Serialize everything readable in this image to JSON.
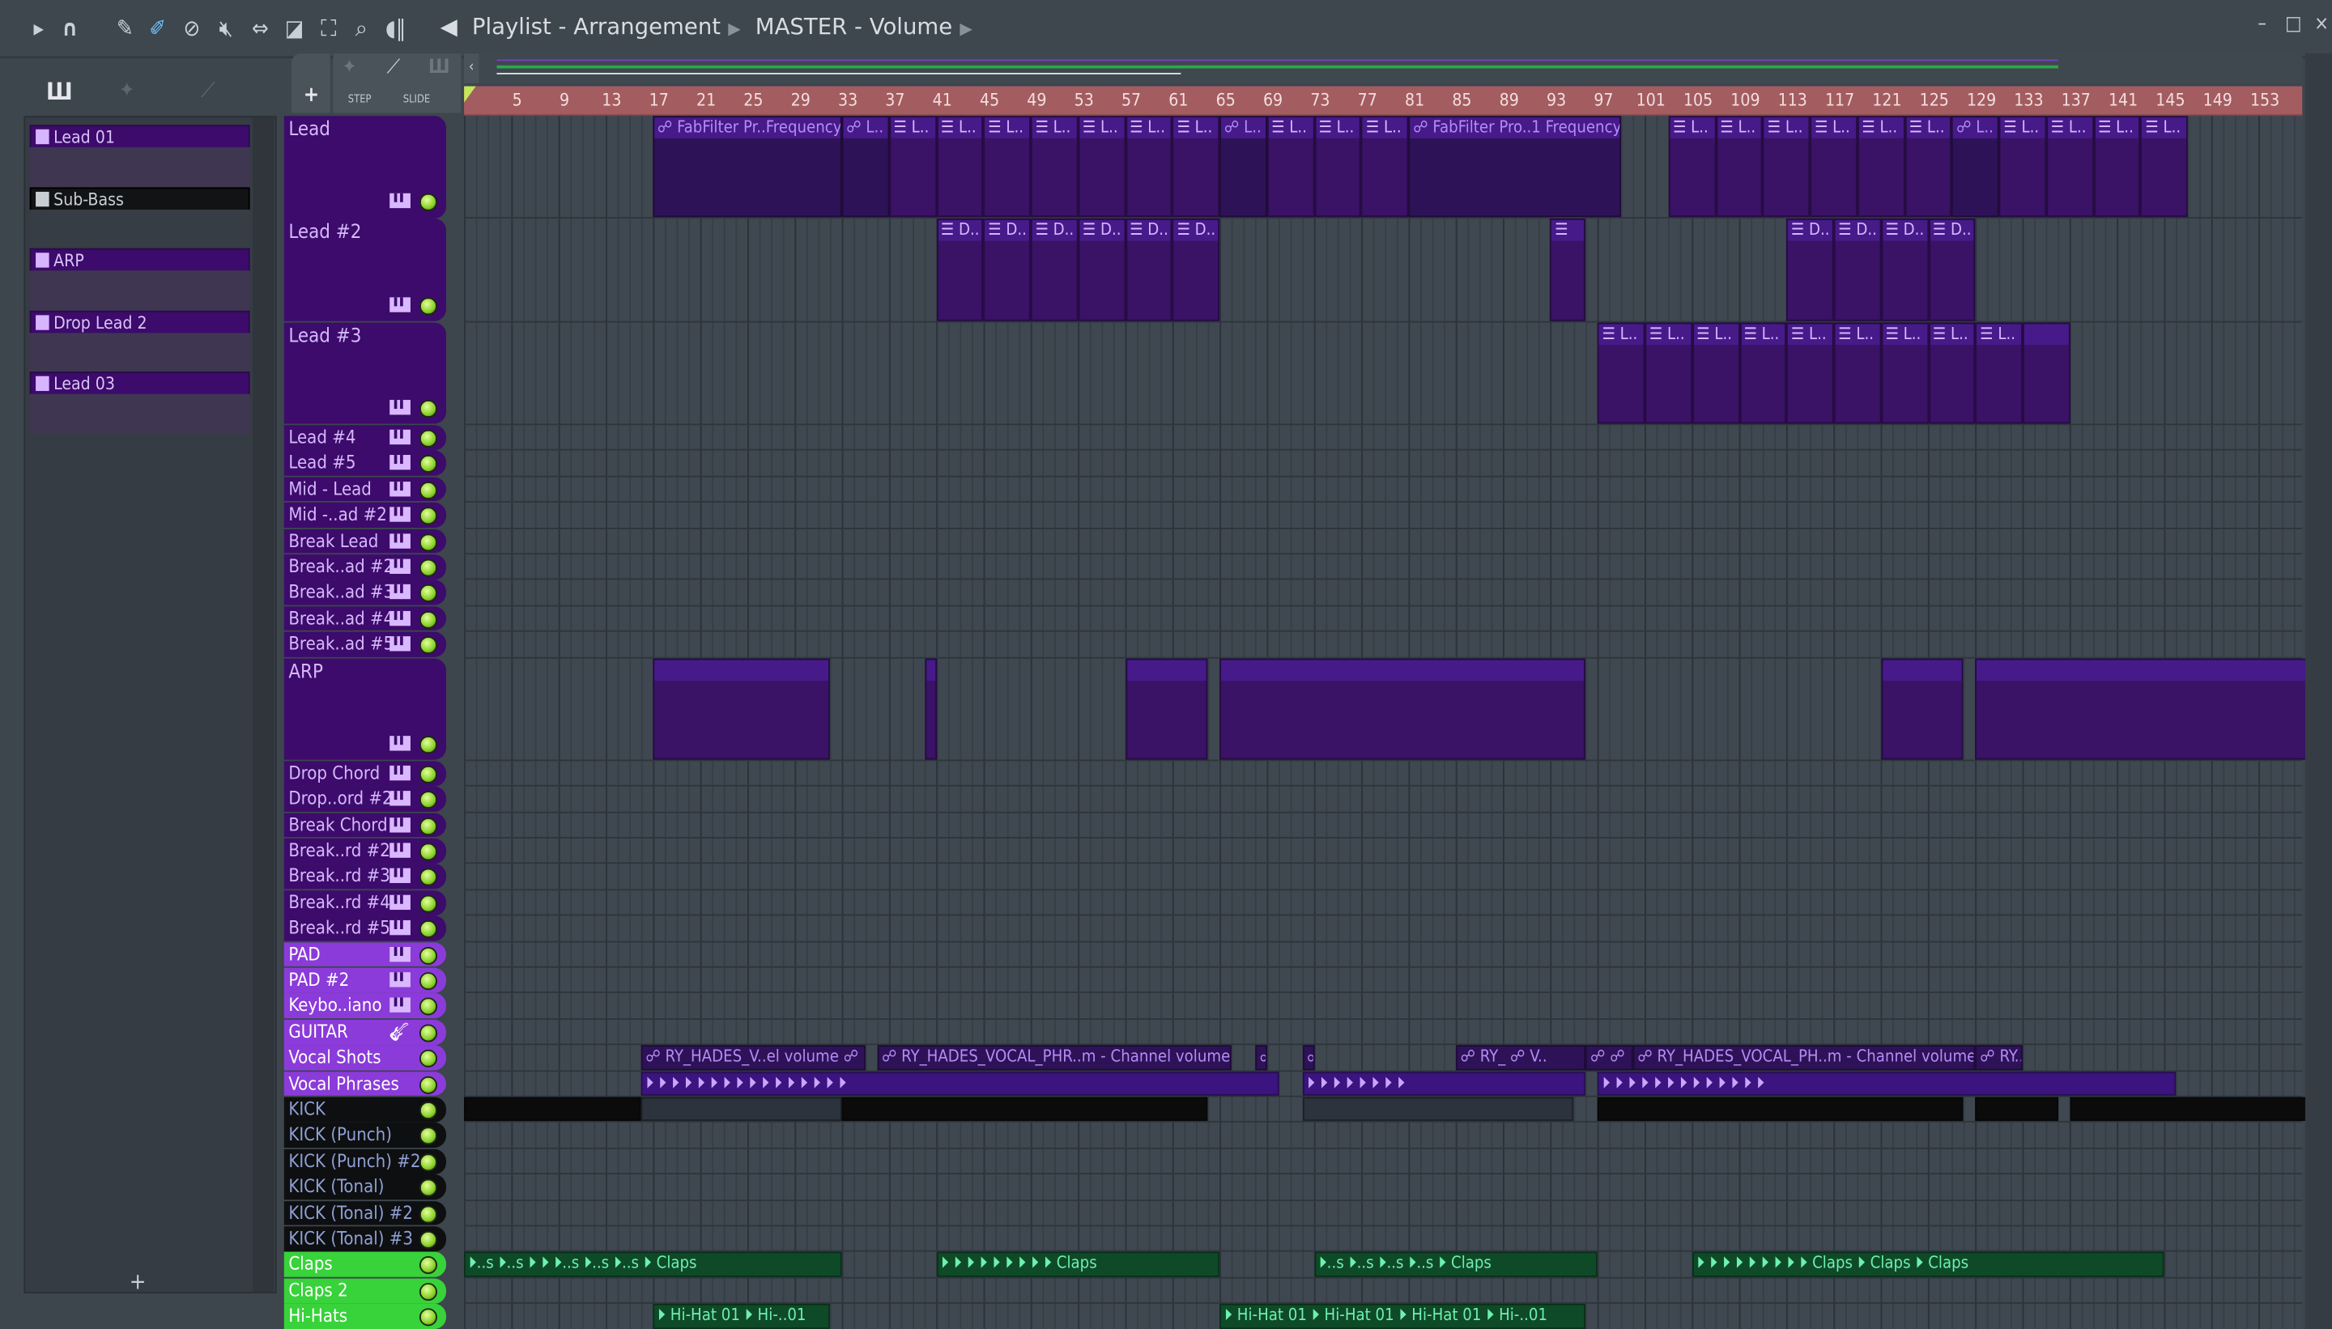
{
  "toolbar": {
    "icons": [
      "play-arrow-icon",
      "magnet-icon",
      "pencil-icon",
      "paint-brush-icon",
      "delete-icon",
      "mute-icon",
      "slip-icon",
      "slice-icon",
      "select-icon",
      "zoom-icon",
      "playback-icon"
    ],
    "breadcrumb": [
      "Playlist - Arrangement",
      "MASTER - Volume"
    ],
    "window": {
      "minimize": "–",
      "maximize": "□",
      "close": "×"
    }
  },
  "header_tools": {
    "add": "+",
    "step": "STEP",
    "slide": "SLIDE"
  },
  "picker": {
    "items": [
      {
        "label": "Lead 01",
        "selected": false
      },
      {
        "label": "Sub-Bass",
        "selected": true
      },
      {
        "label": "ARP",
        "selected": false
      },
      {
        "label": "Drop Lead 2",
        "selected": false
      },
      {
        "label": "Lead 03",
        "selected": false
      }
    ],
    "add": "+"
  },
  "ruler": {
    "bars": [
      "5",
      "9",
      "13",
      "17",
      "21",
      "25",
      "29",
      "33",
      "37",
      "41",
      "45",
      "49",
      "53",
      "57",
      "61",
      "65",
      "69",
      "73",
      "77",
      "81",
      "85",
      "89",
      "93",
      "97",
      "101",
      "105",
      "109",
      "113",
      "117",
      "121",
      "125",
      "129",
      "133",
      "137",
      "141",
      "145",
      "149",
      "153"
    ]
  },
  "colors": {
    "lead": "#3d0b6b",
    "lead_text": "#d5b8fb",
    "bright": "#8b3bd9",
    "kick": "#0e0f10",
    "kick_text": "#8ea0d4",
    "green": "#38d23a",
    "clip_purple": "#3a1266",
    "clip_green": "#0f4a28",
    "clip_black": "#0b0b0b"
  },
  "tracks": [
    {
      "name": "Lead",
      "t": "lead",
      "icon": "piano"
    },
    {
      "name": "Lead #2",
      "t": "lead",
      "icon": "piano"
    },
    {
      "name": "Lead #3",
      "t": "lead",
      "icon": "piano"
    },
    {
      "name": "Lead #4",
      "t": "lead",
      "icon": "piano"
    },
    {
      "name": "Lead #5",
      "t": "lead",
      "icon": "piano"
    },
    {
      "name": "Mid - Lead",
      "t": "lead",
      "icon": "piano"
    },
    {
      "name": "Mid -..ad #2",
      "t": "lead",
      "icon": "piano"
    },
    {
      "name": "Break Lead",
      "t": "lead",
      "icon": "piano"
    },
    {
      "name": "Break..ad #2",
      "t": "lead",
      "icon": "piano"
    },
    {
      "name": "Break..ad #3",
      "t": "lead",
      "icon": "piano"
    },
    {
      "name": "Break..ad #4",
      "t": "lead",
      "icon": "piano"
    },
    {
      "name": "Break..ad #5",
      "t": "lead",
      "icon": "piano"
    },
    {
      "name": "ARP",
      "t": "lead",
      "icon": "piano"
    },
    {
      "name": "Drop Chord",
      "t": "lead",
      "icon": "piano"
    },
    {
      "name": "Drop..ord #2",
      "t": "lead",
      "icon": "piano"
    },
    {
      "name": "Break Chord",
      "t": "lead",
      "icon": "piano"
    },
    {
      "name": "Break..rd #2",
      "t": "lead",
      "icon": "piano"
    },
    {
      "name": "Break..rd #3",
      "t": "lead",
      "icon": "piano"
    },
    {
      "name": "Break..rd #4",
      "t": "lead",
      "icon": "piano"
    },
    {
      "name": "Break..rd #5",
      "t": "lead",
      "icon": "piano"
    },
    {
      "name": "PAD",
      "t": "bright",
      "icon": "piano"
    },
    {
      "name": "PAD #2",
      "t": "bright",
      "icon": "piano"
    },
    {
      "name": "Keybo..iano",
      "t": "bright",
      "icon": "piano"
    },
    {
      "name": "GUITAR",
      "t": "bright",
      "icon": "guitar"
    },
    {
      "name": "Vocal Shots",
      "t": "bright",
      "icon": ""
    },
    {
      "name": "Vocal Phrases",
      "t": "bright",
      "icon": ""
    },
    {
      "name": "KICK",
      "t": "kick",
      "icon": ""
    },
    {
      "name": "KICK  (Punch)",
      "t": "kick",
      "icon": ""
    },
    {
      "name": "KICK  (Punch) #2",
      "t": "kick",
      "icon": ""
    },
    {
      "name": "KICK  (Tonal)",
      "t": "kick",
      "icon": ""
    },
    {
      "name": "KICK  (Tonal) #2",
      "t": "kick",
      "icon": ""
    },
    {
      "name": "KICK  (Tonal) #3",
      "t": "kick",
      "icon": ""
    },
    {
      "name": "Claps",
      "t": "green",
      "icon": ""
    },
    {
      "name": "Claps 2",
      "t": "green",
      "icon": ""
    },
    {
      "name": "Hi-Hats",
      "t": "green",
      "icon": ""
    }
  ],
  "clips": [
    {
      "track": 0,
      "start": 17,
      "len": 16,
      "label": "☍ FabFilter Pr..Frequency",
      "k": "auto"
    },
    {
      "track": 0,
      "start": 33,
      "len": 4,
      "label": "☍ L..",
      "k": "auto"
    },
    {
      "track": 0,
      "start": 37,
      "len": 4,
      "label": "☰ L..",
      "k": "p"
    },
    {
      "track": 0,
      "start": 41,
      "len": 4,
      "label": "☰ L..",
      "k": "p"
    },
    {
      "track": 0,
      "start": 45,
      "len": 4,
      "label": "☰ L..",
      "k": "p"
    },
    {
      "track": 0,
      "start": 49,
      "len": 4,
      "label": "☰ L..",
      "k": "p"
    },
    {
      "track": 0,
      "start": 53,
      "len": 4,
      "label": "☰ L..",
      "k": "p"
    },
    {
      "track": 0,
      "start": 57,
      "len": 4,
      "label": "☰ L..",
      "k": "p"
    },
    {
      "track": 0,
      "start": 61,
      "len": 4,
      "label": "☰ L..",
      "k": "p"
    },
    {
      "track": 0,
      "start": 65,
      "len": 4,
      "label": "☍ L..",
      "k": "auto"
    },
    {
      "track": 0,
      "start": 69,
      "len": 4,
      "label": "☰ L..",
      "k": "p"
    },
    {
      "track": 0,
      "start": 73,
      "len": 4,
      "label": "☰ L..",
      "k": "p"
    },
    {
      "track": 0,
      "start": 77,
      "len": 4,
      "label": "☰ L..",
      "k": "p"
    },
    {
      "track": 0,
      "start": 81,
      "len": 18,
      "label": "☍ FabFilter Pro..1 Frequency",
      "k": "auto"
    },
    {
      "track": 0,
      "start": 103,
      "len": 4,
      "label": "☰ L..",
      "k": "p"
    },
    {
      "track": 0,
      "start": 107,
      "len": 4,
      "label": "☰ L..",
      "k": "p"
    },
    {
      "track": 0,
      "start": 111,
      "len": 4,
      "label": "☰ L..",
      "k": "p"
    },
    {
      "track": 0,
      "start": 115,
      "len": 4,
      "label": "☰ L..",
      "k": "p"
    },
    {
      "track": 0,
      "start": 119,
      "len": 4,
      "label": "☰ L..",
      "k": "p"
    },
    {
      "track": 0,
      "start": 123,
      "len": 4,
      "label": "☰ L..",
      "k": "p"
    },
    {
      "track": 0,
      "start": 127,
      "len": 4,
      "label": "☍ L..",
      "k": "auto"
    },
    {
      "track": 0,
      "start": 131,
      "len": 4,
      "label": "☰ L..",
      "k": "p"
    },
    {
      "track": 0,
      "start": 135,
      "len": 4,
      "label": "☰ L..",
      "k": "p"
    },
    {
      "track": 0,
      "start": 139,
      "len": 4,
      "label": "☰ L..",
      "k": "p"
    },
    {
      "track": 0,
      "start": 143,
      "len": 4,
      "label": "☰ L..",
      "k": "p"
    },
    {
      "track": 1,
      "start": 41,
      "len": 4,
      "label": "☰ D..",
      "k": "p"
    },
    {
      "track": 1,
      "start": 45,
      "len": 4,
      "label": "☰ D..",
      "k": "p"
    },
    {
      "track": 1,
      "start": 49,
      "len": 4,
      "label": "☰ D..",
      "k": "p"
    },
    {
      "track": 1,
      "start": 53,
      "len": 4,
      "label": "☰ D..",
      "k": "p"
    },
    {
      "track": 1,
      "start": 57,
      "len": 4,
      "label": "☰ D..",
      "k": "p"
    },
    {
      "track": 1,
      "start": 61,
      "len": 4,
      "label": "☰ D..",
      "k": "p"
    },
    {
      "track": 1,
      "start": 93,
      "len": 3,
      "label": "☰",
      "k": "p"
    },
    {
      "track": 1,
      "start": 113,
      "len": 4,
      "label": "☰ D..",
      "k": "p"
    },
    {
      "track": 1,
      "start": 117,
      "len": 4,
      "label": "☰ D..",
      "k": "p"
    },
    {
      "track": 1,
      "start": 121,
      "len": 4,
      "label": "☰ D..",
      "k": "p"
    },
    {
      "track": 1,
      "start": 125,
      "len": 4,
      "label": "☰ D..",
      "k": "p"
    },
    {
      "track": 2,
      "start": 97,
      "len": 4,
      "label": "☰ L..",
      "k": "p"
    },
    {
      "track": 2,
      "start": 101,
      "len": 4,
      "label": "☰ L..",
      "k": "p"
    },
    {
      "track": 2,
      "start": 105,
      "len": 4,
      "label": "☰ L..",
      "k": "p"
    },
    {
      "track": 2,
      "start": 109,
      "len": 4,
      "label": "☰ L..",
      "k": "p"
    },
    {
      "track": 2,
      "start": 113,
      "len": 4,
      "label": "☰ L..",
      "k": "p"
    },
    {
      "track": 2,
      "start": 117,
      "len": 4,
      "label": "☰ L..",
      "k": "p"
    },
    {
      "track": 2,
      "start": 121,
      "len": 4,
      "label": "☰ L..",
      "k": "p"
    },
    {
      "track": 2,
      "start": 125,
      "len": 4,
      "label": "☰ L..",
      "k": "p"
    },
    {
      "track": 2,
      "start": 129,
      "len": 4,
      "label": "☰ L..",
      "k": "p"
    },
    {
      "track": 2,
      "start": 133,
      "len": 4,
      "label": "",
      "k": "p"
    },
    {
      "track": 12,
      "start": 17,
      "len": 15,
      "label": "",
      "k": "p"
    },
    {
      "track": 12,
      "start": 40,
      "len": 1,
      "label": "",
      "k": "p"
    },
    {
      "track": 12,
      "start": 57,
      "len": 7,
      "label": "",
      "k": "p"
    },
    {
      "track": 12,
      "start": 65,
      "len": 31,
      "label": "",
      "k": "p"
    },
    {
      "track": 12,
      "start": 121,
      "len": 7,
      "label": "",
      "k": "p"
    },
    {
      "track": 12,
      "start": 129,
      "len": 28,
      "label": "",
      "k": "p"
    },
    {
      "track": 24,
      "start": 16,
      "len": 19,
      "label": "☍ RY_HADES_V..el volume ☍",
      "k": "auto"
    },
    {
      "track": 24,
      "start": 36,
      "len": 30,
      "label": "☍ RY_HADES_VOCAL_PHR..m - Channel volume",
      "k": "auto"
    },
    {
      "track": 24,
      "start": 68,
      "len": 1,
      "label": "☍",
      "k": "auto"
    },
    {
      "track": 24,
      "start": 72,
      "len": 1,
      "label": "☍",
      "k": "auto"
    },
    {
      "track": 24,
      "start": 85,
      "len": 11,
      "label": "☍ RY_ ☍ V..",
      "k": "auto"
    },
    {
      "track": 24,
      "start": 96,
      "len": 4,
      "label": "☍ ☍",
      "k": "auto"
    },
    {
      "track": 24,
      "start": 100,
      "len": 29,
      "label": "☍ RY_HADES_VOCAL_PH..m - Channel volume",
      "k": "auto"
    },
    {
      "track": 24,
      "start": 129,
      "len": 4,
      "label": "☍ RY..",
      "k": "auto"
    },
    {
      "track": 25,
      "start": 16,
      "len": 54,
      "label": "⏵ ⏵ ⏵ ⏵ ⏵ ⏵ ⏵ ⏵ ⏵ ⏵ ⏵ ⏵ ⏵ ⏵ ⏵ ⏵",
      "k": "a"
    },
    {
      "track": 25,
      "start": 72,
      "len": 24,
      "label": "⏵ ⏵ ⏵ ⏵ ⏵ ⏵ ⏵ ⏵",
      "k": "a"
    },
    {
      "track": 25,
      "start": 97,
      "len": 49,
      "label": "⏵ ⏵ ⏵ ⏵ ⏵ ⏵ ⏵ ⏵ ⏵ ⏵ ⏵ ⏵ ⏵",
      "k": "a"
    },
    {
      "track": 26,
      "start": 1,
      "len": 15,
      "label": "",
      "k": "k"
    },
    {
      "track": 26,
      "start": 16,
      "len": 17,
      "label": "",
      "k": "kg"
    },
    {
      "track": 26,
      "start": 33,
      "len": 31,
      "label": "",
      "k": "k"
    },
    {
      "track": 26,
      "start": 72,
      "len": 23,
      "label": "",
      "k": "kg"
    },
    {
      "track": 26,
      "start": 97,
      "len": 31,
      "label": "",
      "k": "k"
    },
    {
      "track": 26,
      "start": 129,
      "len": 7,
      "label": "",
      "k": "k"
    },
    {
      "track": 26,
      "start": 137,
      "len": 20,
      "label": "",
      "k": "k"
    },
    {
      "track": 32,
      "start": 1,
      "len": 32,
      "label": "⏵..s ⏵..s ⏵ ⏵ ⏵..s ⏵..s ⏵..s ⏵ Claps",
      "k": "g"
    },
    {
      "track": 32,
      "start": 41,
      "len": 24,
      "label": "⏵ ⏵ ⏵ ⏵ ⏵ ⏵ ⏵ ⏵ ⏵ Claps",
      "k": "g"
    },
    {
      "track": 32,
      "start": 73,
      "len": 24,
      "label": "⏵..s ⏵..s ⏵..s ⏵..s ⏵ Claps",
      "k": "g"
    },
    {
      "track": 32,
      "start": 105,
      "len": 40,
      "label": "⏵ ⏵ ⏵ ⏵ ⏵ ⏵ ⏵ ⏵ ⏵ Claps ⏵ Claps ⏵ Claps",
      "k": "g"
    },
    {
      "track": 34,
      "start": 17,
      "len": 15,
      "label": "⏵ Hi-Hat 01 ⏵ Hi-..01",
      "k": "g"
    },
    {
      "track": 34,
      "start": 65,
      "len": 31,
      "label": "⏵ Hi-Hat 01 ⏵ Hi-Hat 01 ⏵ Hi-Hat 01 ⏵ Hi-..01",
      "k": "g"
    }
  ]
}
